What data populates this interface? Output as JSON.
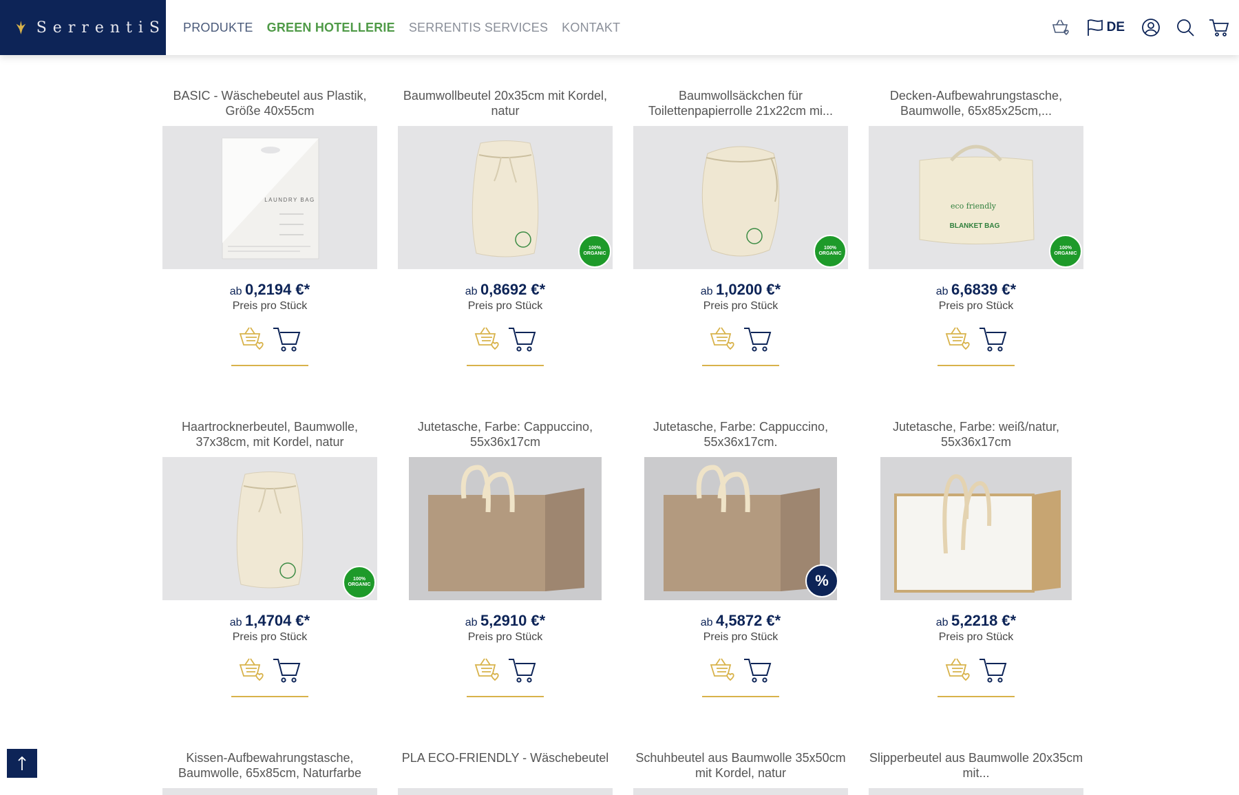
{
  "brand": {
    "name": "SerrentiS"
  },
  "nav": {
    "items": [
      {
        "label": "PRODUKTE"
      },
      {
        "label": "GREEN HOTELLERIE"
      },
      {
        "label": "SERRENTIS SERVICES"
      },
      {
        "label": "KONTAKT"
      }
    ]
  },
  "header": {
    "language": "DE"
  },
  "price_prefix": "ab",
  "price_unit": "Preis pro Stück",
  "badges": {
    "organic_line1": "100%",
    "organic_line2": "ORGANIC",
    "sale": "%"
  },
  "products": [
    {
      "title": "BASIC - Wäschebeutel aus Plastik, Größe 40x55cm",
      "price": "0,2194 €*",
      "badge": "none",
      "image": "plastic-laundry-bag",
      "image_text": "LAUNDRY BAG"
    },
    {
      "title": "Baumwollbeutel 20x35cm mit Kordel, natur",
      "price": "0,8692 €*",
      "badge": "organic",
      "image": "cotton-drawstring-bag"
    },
    {
      "title": "Baumwollsäckchen für Toilettenpapierrolle 21x22cm mi...",
      "price": "1,0200 €*",
      "badge": "organic",
      "image": "cotton-pouch"
    },
    {
      "title": "Decken-Aufbewahrungstasche, Baumwolle, 65x85x25cm,...",
      "price": "6,6839 €*",
      "badge": "organic",
      "image": "blanket-bag",
      "image_text_1": "eco friendly",
      "image_text_2": "BLANKET BAG"
    },
    {
      "title": "Haartrocknerbeutel, Baumwolle, 37x38cm, mit Kordel, natur",
      "price": "1,4704 €*",
      "badge": "organic",
      "image": "cotton-drawstring-bag"
    },
    {
      "title": "Jutetasche, Farbe: Cappuccino, 55x36x17cm",
      "price": "5,2910 €*",
      "badge": "none",
      "image": "jute-bag-cappuccino"
    },
    {
      "title": "Jutetasche, Farbe: Cappuccino, 55x36x17cm.",
      "price": "4,5872 €*",
      "badge": "sale",
      "image": "jute-bag-cappuccino"
    },
    {
      "title": "Jutetasche, Farbe: weiß/natur, 55x36x17cm",
      "price": "5,2218 €*",
      "badge": "none",
      "image": "jute-bag-white"
    },
    {
      "title": "Kissen-Aufbewahrungstasche, Baumwolle, 65x85cm, Naturfarbe",
      "price": "",
      "badge": "none",
      "image": ""
    },
    {
      "title": "PLA ECO-FRIENDLY - Wäschebeutel",
      "price": "",
      "badge": "none",
      "image": ""
    },
    {
      "title": "Schuhbeutel aus Baumwolle 35x50cm mit Kordel, natur",
      "price": "",
      "badge": "none",
      "image": ""
    },
    {
      "title": "Slipperbeutel aus Baumwolle 20x35cm mit...",
      "price": "",
      "badge": "none",
      "image": ""
    }
  ],
  "colors": {
    "navy": "#0d2457",
    "green": "#4f9a47",
    "gold": "#d8b24a",
    "organic": "#1e9a2a"
  },
  "icons": [
    "wishlist-basket-icon",
    "flag-icon",
    "user-icon",
    "search-icon",
    "cart-icon",
    "arrow-up-icon"
  ]
}
